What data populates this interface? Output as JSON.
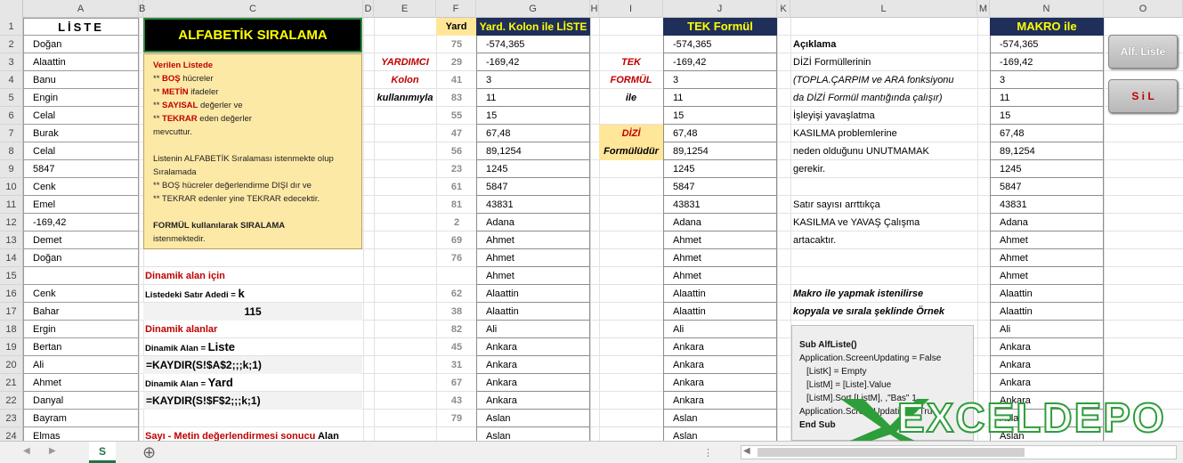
{
  "columns": [
    "A",
    "B",
    "C",
    "D",
    "E",
    "F",
    "G",
    "H",
    "I",
    "J",
    "K",
    "L",
    "M",
    "N",
    "O"
  ],
  "rows": [
    "2",
    "3",
    "4",
    "5",
    "6",
    "7",
    "8",
    "9",
    "10",
    "11",
    "12",
    "13",
    "14",
    "15",
    "16",
    "17",
    "18",
    "19",
    "20",
    "21",
    "22",
    "23",
    "24"
  ],
  "list_header": "LİSTE",
  "list": [
    "Doğan",
    "Alaattin",
    "Banu",
    "Engin",
    "Celal",
    "Burak",
    "Celal",
    "5847",
    "Cenk",
    "Emel",
    "-169,42",
    "Demet",
    "Doğan",
    "",
    "Cenk",
    "Bahar",
    "Ergin",
    "Bertan",
    "Ali",
    "Ahmet",
    "Danyal",
    "Bayram",
    "Elmas"
  ],
  "title": "ALFABETİK  SIRALAMA",
  "note": {
    "l1": "Verilen Listede",
    "l2a": "** ",
    "l2b": "BOŞ",
    "l2c": " hücreler",
    "l3a": "** ",
    "l3b": "METİN",
    "l3c": " ifadeler",
    "l4a": "** ",
    "l4b": "SAYISAL",
    "l4c": " değerler ve",
    "l5a": "** ",
    "l5b": "TEKRAR",
    "l5c": " eden değerler",
    "l6": "mevcuttur.",
    "l7": "Listenin ALFABETİK Sıralaması istenmekte olup",
    "l8": "Sıralamada",
    "l9": "** BOŞ hücreler değerlendirme DIŞI dır ve",
    "l10": "** TEKRAR edenler yine TEKRAR edecektir.",
    "l11a": "FORMÜL kullanılarak SIRALAMA",
    "l12": "istenmektedir."
  },
  "left_panel": {
    "dyn_title": "Dinamik alan için",
    "row_count_label": "Listedeki Satır Adedi =",
    "row_count_var": "k",
    "row_count_value": "115",
    "dyn_areas": "Dinamik alanlar",
    "dyn_area_label1": "Dinamik Alan =",
    "dyn_area_name1": "Liste",
    "formula1": "=KAYDIR(S!$A$2;;;k;1)",
    "dyn_area_label2": "Dinamik Alan =",
    "dyn_area_name2": "Yard",
    "formula2": "=KAYDIR(S!$F$2;;;k;1)",
    "bottom_red": "Sayı - Metin  değerlendirmesi sonucu",
    "bottom_black": "Alan"
  },
  "helper_text": {
    "l1": "YARDIMCI",
    "l2": "Kolon",
    "l3": "kullanımıyla"
  },
  "yard_header": "Yard",
  "yard": [
    "75",
    "29",
    "41",
    "83",
    "55",
    "47",
    "56",
    "23",
    "61",
    "81",
    "2",
    "69",
    "76",
    "",
    "62",
    "38",
    "82",
    "45",
    "31",
    "67",
    "43",
    "79"
  ],
  "g_header": "Yard. Kolon ile LİSTE",
  "sorted": [
    "-574,365",
    "-169,42",
    "3",
    "11",
    "15",
    "67,48",
    "89,1254",
    "1245",
    "5847",
    "43831",
    "Adana",
    "Ahmet",
    "Ahmet",
    "Ahmet",
    "Alaattin",
    "Alaattin",
    "Ali",
    "Ankara",
    "Ankara",
    "Ankara",
    "Ankara",
    "Aslan",
    "Aslan"
  ],
  "i_text": {
    "l1": "TEK",
    "l2": "FORMÜL",
    "l3": "ile",
    "l4": "DİZİ",
    "l5": "Formülüdür"
  },
  "j_header": "TEK  Formül",
  "explain": {
    "l1": "Açıklama",
    "l2": "DİZİ Formüllerinin",
    "l3": "(TOPLA.ÇARPIM  ve  ARA fonksiyonu",
    "l4": "da DİZİ Formül mantığında çalışır)",
    "l5": "İşleyişi yavaşlatma",
    "l6": "KASILMA problemlerine",
    "l7": "neden olduğunu UNUTMAMAK",
    "l8": "gerekir.",
    "l9": "Satır sayısı arrttıkça",
    "l10": "KASILMA ve YAVAŞ Çalışma",
    "l11": "artacaktır.",
    "l12": "Makro ile yapmak istenilirse",
    "l13": "kopyala ve sırala şeklinde Örnek"
  },
  "code": {
    "l1": "Sub AlfListe()",
    "l2": "Application.ScreenUpdating = False",
    "l3": "[ListK] = Empty",
    "l4": "[ListM] = [Liste].Value",
    "l5": "[ListM].Sort [ListM], ,\"Bas\"  1",
    "l6": "Application.ScreenUpdating = True",
    "l7": "End Sub"
  },
  "n_header": "MAKRO  ile",
  "buttons": {
    "alf": "Alf. Liste",
    "sil": "S i L"
  },
  "sheet_tab": "S",
  "add_sheet": "⊕",
  "logo": {
    "x": "X",
    "text1": "EXCEL",
    "text2": "DEPO"
  },
  "colors": {
    "header_navy": "#1f2f5a",
    "header_yellow": "#ffff00",
    "yard_bg": "#ffe699",
    "note_bg": "#fde9a6",
    "red": "#c00000",
    "logo_green": "#2e9e3a"
  }
}
